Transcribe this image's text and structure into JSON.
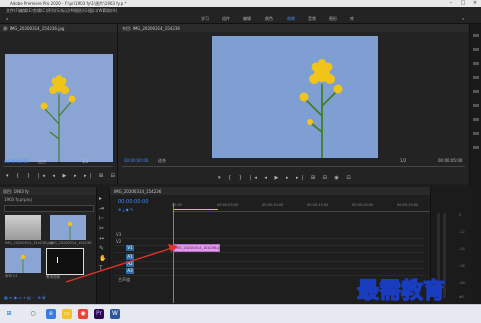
{
  "app": {
    "title": "Adobe Premiere Pro 2020 - F:\\pr\\1903 fy\\1\\图片\\1903 fy.p *",
    "menu": [
      "文件(F)",
      "编辑(E)",
      "剪辑(C)",
      "序列(S)",
      "标记(M)",
      "图形(G)",
      "窗口(W)",
      "帮助(H)"
    ],
    "workspaces": [
      "学习",
      "组件",
      "编辑",
      "颜色",
      "效果",
      "音频",
      "图形",
      "库"
    ],
    "active_workspace": "效果"
  },
  "source": {
    "tab": "源: IMG_20200314_154236.jpg",
    "timecode": "00:00:00:00",
    "fit": "适合",
    "frac": "1/2"
  },
  "program": {
    "tab": "节目: IMG_20200314_154236",
    "timecode": "00:00:00:00",
    "fit": "适合",
    "frac": "1/2",
    "duration": "00:00:05:00"
  },
  "project": {
    "tab": "项目: 1903 fy",
    "path": "1903 fy.prproj",
    "items": [
      {
        "name": "IMG_20200314_154236.jpg",
        "dur": "5:00"
      },
      {
        "name": "IMG_20200314_154236",
        "dur": "5:00"
      },
      {
        "name": "序列 01",
        "dur": "5:00"
      },
      {
        "name": "黑场视频",
        "dur": "5:00"
      }
    ]
  },
  "timeline": {
    "tab": "IMG_20200314_154236",
    "timecode": "00:00:00:00",
    "ruler": [
      "00:00",
      "00:00:05:00",
      "00:00:10:00",
      "00:00:15:00",
      "00:00:20:00",
      "00:00:25:00"
    ],
    "tracks": [
      "V3",
      "V2",
      "V1",
      "A1",
      "A2",
      "A3"
    ],
    "clip": "IMG_20200314_154236.jpg",
    "master": "主声道"
  },
  "meter": {
    "labels": [
      "0",
      "-12",
      "-24",
      "-36",
      "-48",
      "dB"
    ]
  },
  "watermark": "最需教育",
  "colors": {
    "accent": "#3f8bff",
    "clip": "#e59bf0",
    "sky": "#8aa5d4",
    "flower": "#f0c419"
  }
}
